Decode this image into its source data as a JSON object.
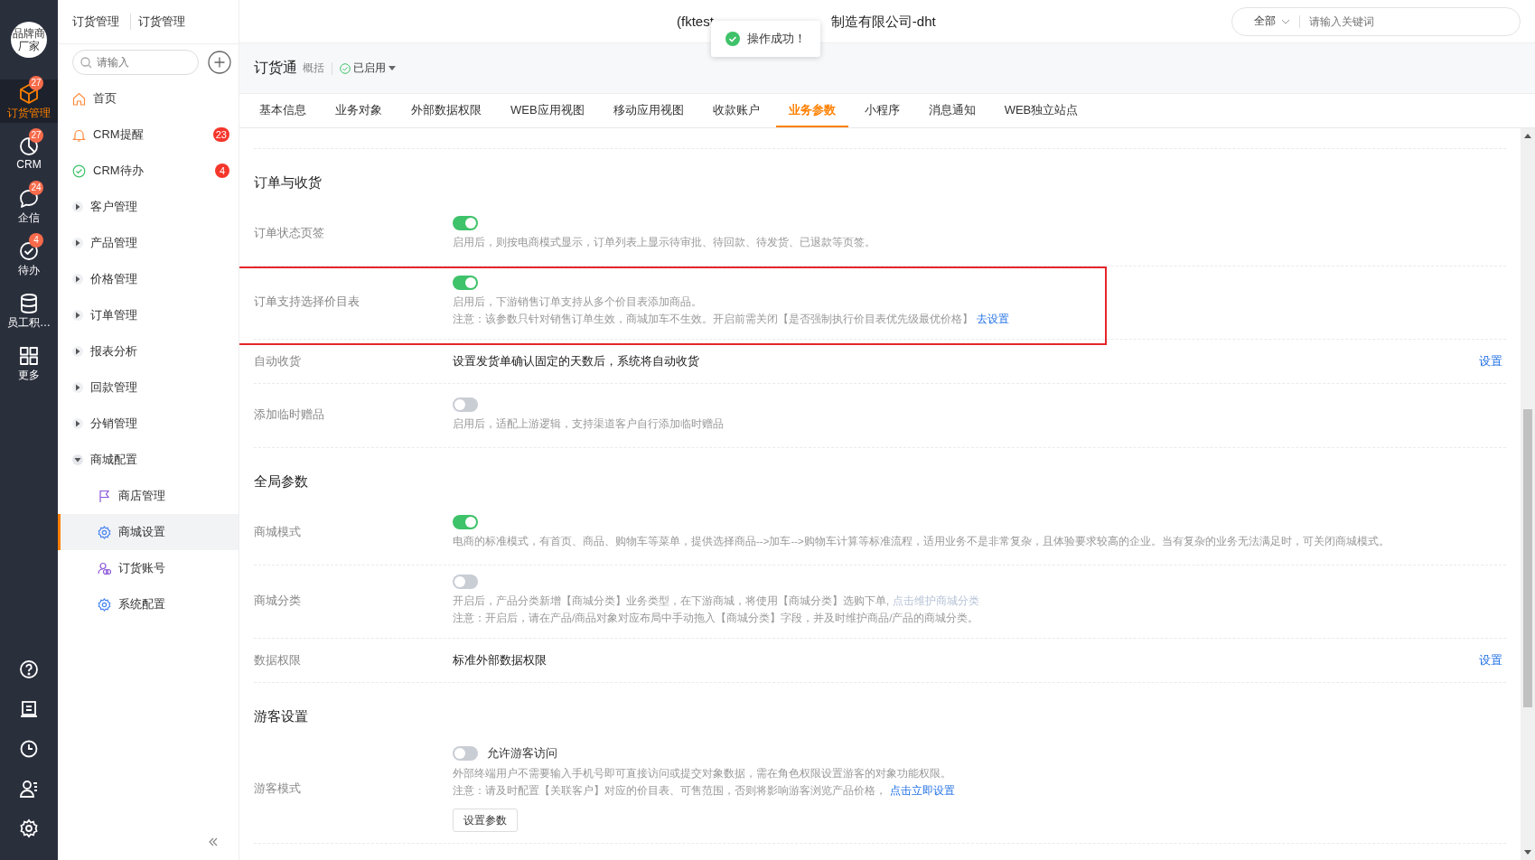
{
  "rail": {
    "brand": [
      "品牌商",
      "厂家"
    ],
    "items": [
      {
        "label": "订货管理",
        "badge": "27",
        "selected": true
      },
      {
        "label": "CRM",
        "badge": "27",
        "selected": false
      },
      {
        "label": "企信",
        "badge": "24",
        "selected": false
      },
      {
        "label": "待办",
        "badge": "4",
        "selected": false
      },
      {
        "label": "员工积…",
        "selected": false
      },
      {
        "label": "更多",
        "selected": false
      }
    ]
  },
  "breadcrumb": [
    "订货管理",
    "订货管理"
  ],
  "window_title": {
    "left": "(fktest",
    "right": "制造有限公司-dht"
  },
  "toast": "操作成功！",
  "search": {
    "scope": "全部",
    "placeholder": "请输入关键词"
  },
  "sidebar": {
    "search_placeholder": "请输入",
    "items": [
      {
        "label": "首页",
        "selected": false
      },
      {
        "label": "CRM提醒",
        "badge": "23",
        "selected": false
      },
      {
        "label": "CRM待办",
        "badge": "4",
        "selected": false
      },
      {
        "label": "客户管理",
        "expanded": false,
        "selected": false
      },
      {
        "label": "产品管理",
        "expanded": false,
        "selected": false
      },
      {
        "label": "价格管理",
        "expanded": false,
        "selected": false
      },
      {
        "label": "订单管理",
        "expanded": false,
        "selected": false
      },
      {
        "label": "报表分析",
        "expanded": false,
        "selected": false
      },
      {
        "label": "回款管理",
        "expanded": false,
        "selected": false
      },
      {
        "label": "分销管理",
        "expanded": false,
        "selected": false
      },
      {
        "label": "商城配置",
        "expanded": true,
        "selected": false,
        "children": [
          {
            "label": "商店管理",
            "selected": false
          },
          {
            "label": "商城设置",
            "selected": true
          },
          {
            "label": "订货账号",
            "selected": false
          },
          {
            "label": "系统配置",
            "selected": false
          }
        ]
      }
    ]
  },
  "app": {
    "title": "订货通",
    "summary": "概括",
    "status": "已启用"
  },
  "tabs": [
    {
      "label": "基本信息",
      "selected": false
    },
    {
      "label": "业务对象",
      "selected": false
    },
    {
      "label": "外部数据权限",
      "selected": false
    },
    {
      "label": "WEB应用视图",
      "selected": false
    },
    {
      "label": "移动应用视图",
      "selected": false
    },
    {
      "label": "收款账户",
      "selected": false
    },
    {
      "label": "业务参数",
      "selected": true
    },
    {
      "label": "小程序",
      "selected": false
    },
    {
      "label": "消息通知",
      "selected": false
    },
    {
      "label": "WEB独立站点",
      "selected": false
    }
  ],
  "sections": [
    {
      "title": "订单与收货",
      "rows": [
        {
          "kind": "toggle",
          "label": "订单状态页签",
          "on": true,
          "highlighted": false,
          "lines": [
            {
              "text": "启用后，则按电商模式显示，订单列表上显示待审批、待回款、待发货、已退款等页签。"
            }
          ]
        },
        {
          "kind": "toggle",
          "label": "订单支持选择价目表",
          "on": true,
          "highlighted": true,
          "lines": [
            {
              "text": "启用后，下游销售订单支持从多个价目表添加商品。"
            },
            {
              "text": "注意：该参数只针对销售订单生效，商城加车不生效。开启前需关闭【是否强制执行价目表优先级最优价格】",
              "link": "去设置",
              "link_muted": false
            }
          ]
        },
        {
          "kind": "text",
          "label": "自动收货",
          "value": "设置发货单确认固定的天数后，系统将自动收货",
          "action": "设置"
        },
        {
          "kind": "toggle",
          "label": "添加临时赠品",
          "on": false,
          "highlighted": false,
          "lines": [
            {
              "text": "启用后，适配上游逻辑，支持渠道客户自行添加临时赠品"
            }
          ]
        }
      ]
    },
    {
      "title": "全局参数",
      "rows": [
        {
          "kind": "toggle",
          "label": "商城模式",
          "on": true,
          "highlighted": false,
          "lines": [
            {
              "text": "电商的标准模式，有首页、商品、购物车等菜单，提供选择商品-->加车-->购物车计算等标准流程，适用业务不是非常复杂，且体验要求较高的企业。当有复杂的业务无法满足时，可关闭商城模式。"
            }
          ]
        },
        {
          "kind": "toggle",
          "label": "商城分类",
          "on": false,
          "highlighted": false,
          "lines": [
            {
              "text": "开启后，产品分类新增【商城分类】业务类型，在下游商城，将使用【商城分类】选购下单,",
              "link": "点击维护商城分类",
              "link_muted": true
            },
            {
              "text": "注意：开启后，请在产品/商品对象对应布局中手动拖入【商城分类】字段，并及时维护商品/产品的商城分类。"
            }
          ]
        },
        {
          "kind": "text",
          "label": "数据权限",
          "value": "标准外部数据权限",
          "action": "设置"
        }
      ]
    },
    {
      "title": "游客设置",
      "rows": [
        {
          "kind": "toggle",
          "label": "游客模式",
          "on": false,
          "highlighted": false,
          "toggle_label": "允许游客访问",
          "button": "设置参数",
          "lines": [
            {
              "text": "外部终端用户不需要输入手机号即可直接访问或提交对象数据，需在角色权限设置游客的对象功能权限。"
            },
            {
              "text": "注意：请及时配置【关联客户】对应的价目表、可售范围，否则将影响游客浏览产品价格，",
              "link": "点击立即设置",
              "link_muted": false
            }
          ]
        }
      ]
    }
  ]
}
